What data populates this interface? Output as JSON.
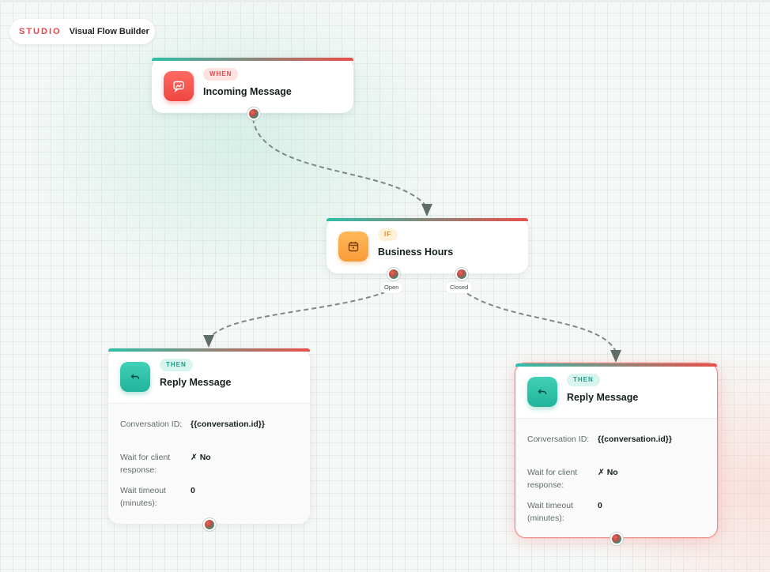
{
  "app": {
    "brand": "STUDIO",
    "title": "Visual Flow Builder"
  },
  "nodes": {
    "trigger": {
      "badge": "WHEN",
      "title": "Incoming Message",
      "icon": "message-image-icon"
    },
    "condition": {
      "badge": "IF",
      "title": "Business Hours",
      "icon": "calendar-icon",
      "outputs": [
        "Open",
        "Closed"
      ]
    },
    "reply_open": {
      "badge": "THEN",
      "title": "Reply Message",
      "icon": "reply-arrow-icon",
      "fields": [
        {
          "label": "Conversation ID:",
          "value": "{{conversation.id}}"
        },
        {
          "label": "Wait for client response:",
          "value": "✗ No"
        },
        {
          "label": "Wait timeout (minutes):",
          "value": "0"
        }
      ]
    },
    "reply_closed": {
      "badge": "THEN",
      "title": "Reply Message",
      "icon": "reply-arrow-icon",
      "selected": true,
      "fields": [
        {
          "label": "Conversation ID:",
          "value": "{{conversation.id}}"
        },
        {
          "label": "Wait for client response:",
          "value": "✗ No"
        },
        {
          "label": "Wait timeout (minutes):",
          "value": "0"
        }
      ]
    }
  },
  "colors": {
    "accent_red": "#e5484d",
    "accent_teal": "#22b39c",
    "accent_orange": "#f89c37",
    "connector": "#7d8a86"
  }
}
